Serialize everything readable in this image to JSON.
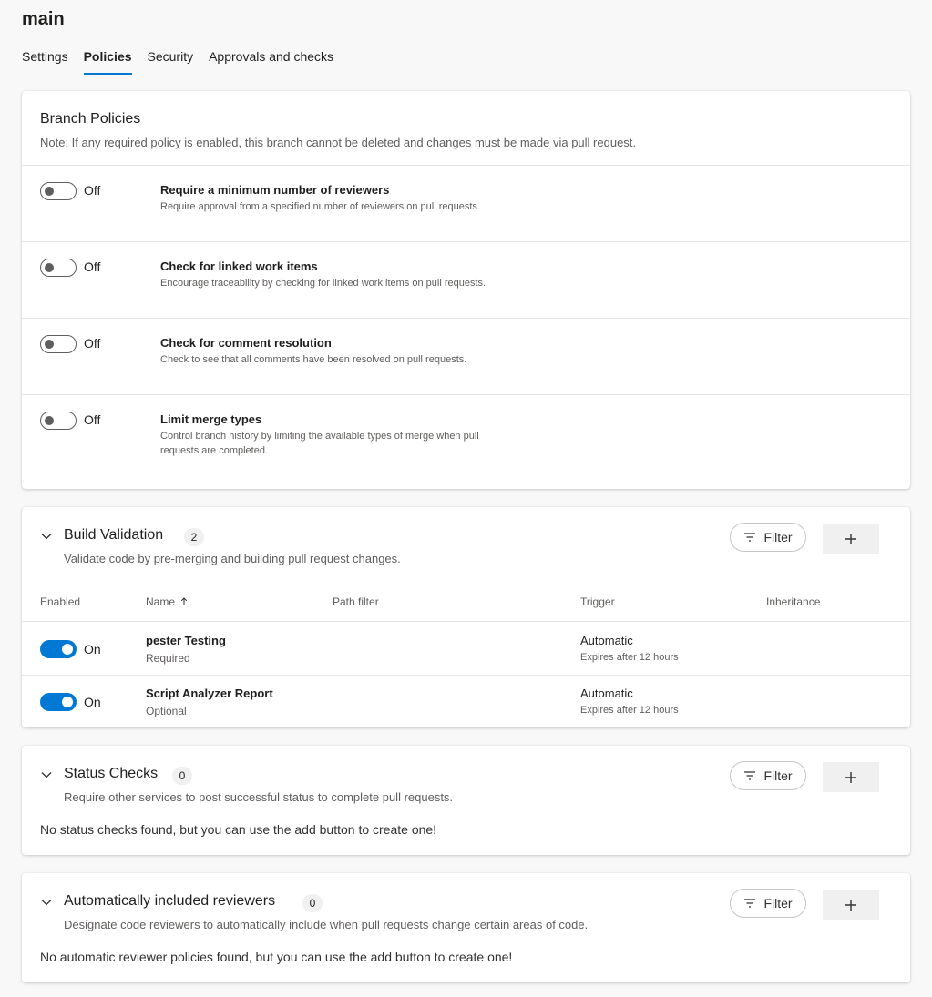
{
  "page": {
    "title": "main",
    "tabs": [
      {
        "label": "Settings"
      },
      {
        "label": "Policies"
      },
      {
        "label": "Security"
      },
      {
        "label": "Approvals and checks"
      }
    ],
    "active_tab": "Policies"
  },
  "branch_policies": {
    "title": "Branch Policies",
    "note": "Note: If any required policy is enabled, this branch cannot be deleted and changes must be made via pull request.",
    "policies": [
      {
        "state": "Off",
        "title": "Require a minimum number of reviewers",
        "desc": "Require approval from a specified number of reviewers on pull requests."
      },
      {
        "state": "Off",
        "title": "Check for linked work items",
        "desc": "Encourage traceability by checking for linked work items on pull requests."
      },
      {
        "state": "Off",
        "title": "Check for comment resolution",
        "desc": "Check to see that all comments have been resolved on pull requests."
      },
      {
        "state": "Off",
        "title": "Limit merge types",
        "desc": "Control branch history by limiting the available types of merge when pull requests are completed."
      }
    ]
  },
  "build_validation": {
    "title": "Build Validation",
    "count": "2",
    "desc": "Validate code by pre-merging and building pull request changes.",
    "filter_label": "Filter",
    "columns": {
      "enabled": "Enabled",
      "name": "Name",
      "path_filter": "Path filter",
      "trigger": "Trigger",
      "inheritance": "Inheritance"
    },
    "rows": [
      {
        "state": "On",
        "name": "pester Testing",
        "requirement": "Required",
        "trigger": "Automatic",
        "expires": "Expires after 12 hours"
      },
      {
        "state": "On",
        "name": "Script Analyzer Report",
        "requirement": "Optional",
        "trigger": "Automatic",
        "expires": "Expires after 12 hours"
      }
    ]
  },
  "status_checks": {
    "title": "Status Checks",
    "count": "0",
    "desc": "Require other services to post successful status to complete pull requests.",
    "filter_label": "Filter",
    "empty": "No status checks found, but you can use the add button to create one!"
  },
  "auto_reviewers": {
    "title": "Automatically included reviewers",
    "count": "0",
    "desc": "Designate code reviewers to automatically include when pull requests change certain areas of code.",
    "filter_label": "Filter",
    "empty": "No automatic reviewer policies found, but you can use the add button to create one!"
  },
  "colors": {
    "accent": "#0078d4",
    "text": "#201f1e",
    "secondary_text": "#605e5c",
    "background": "#f8f8f8"
  }
}
